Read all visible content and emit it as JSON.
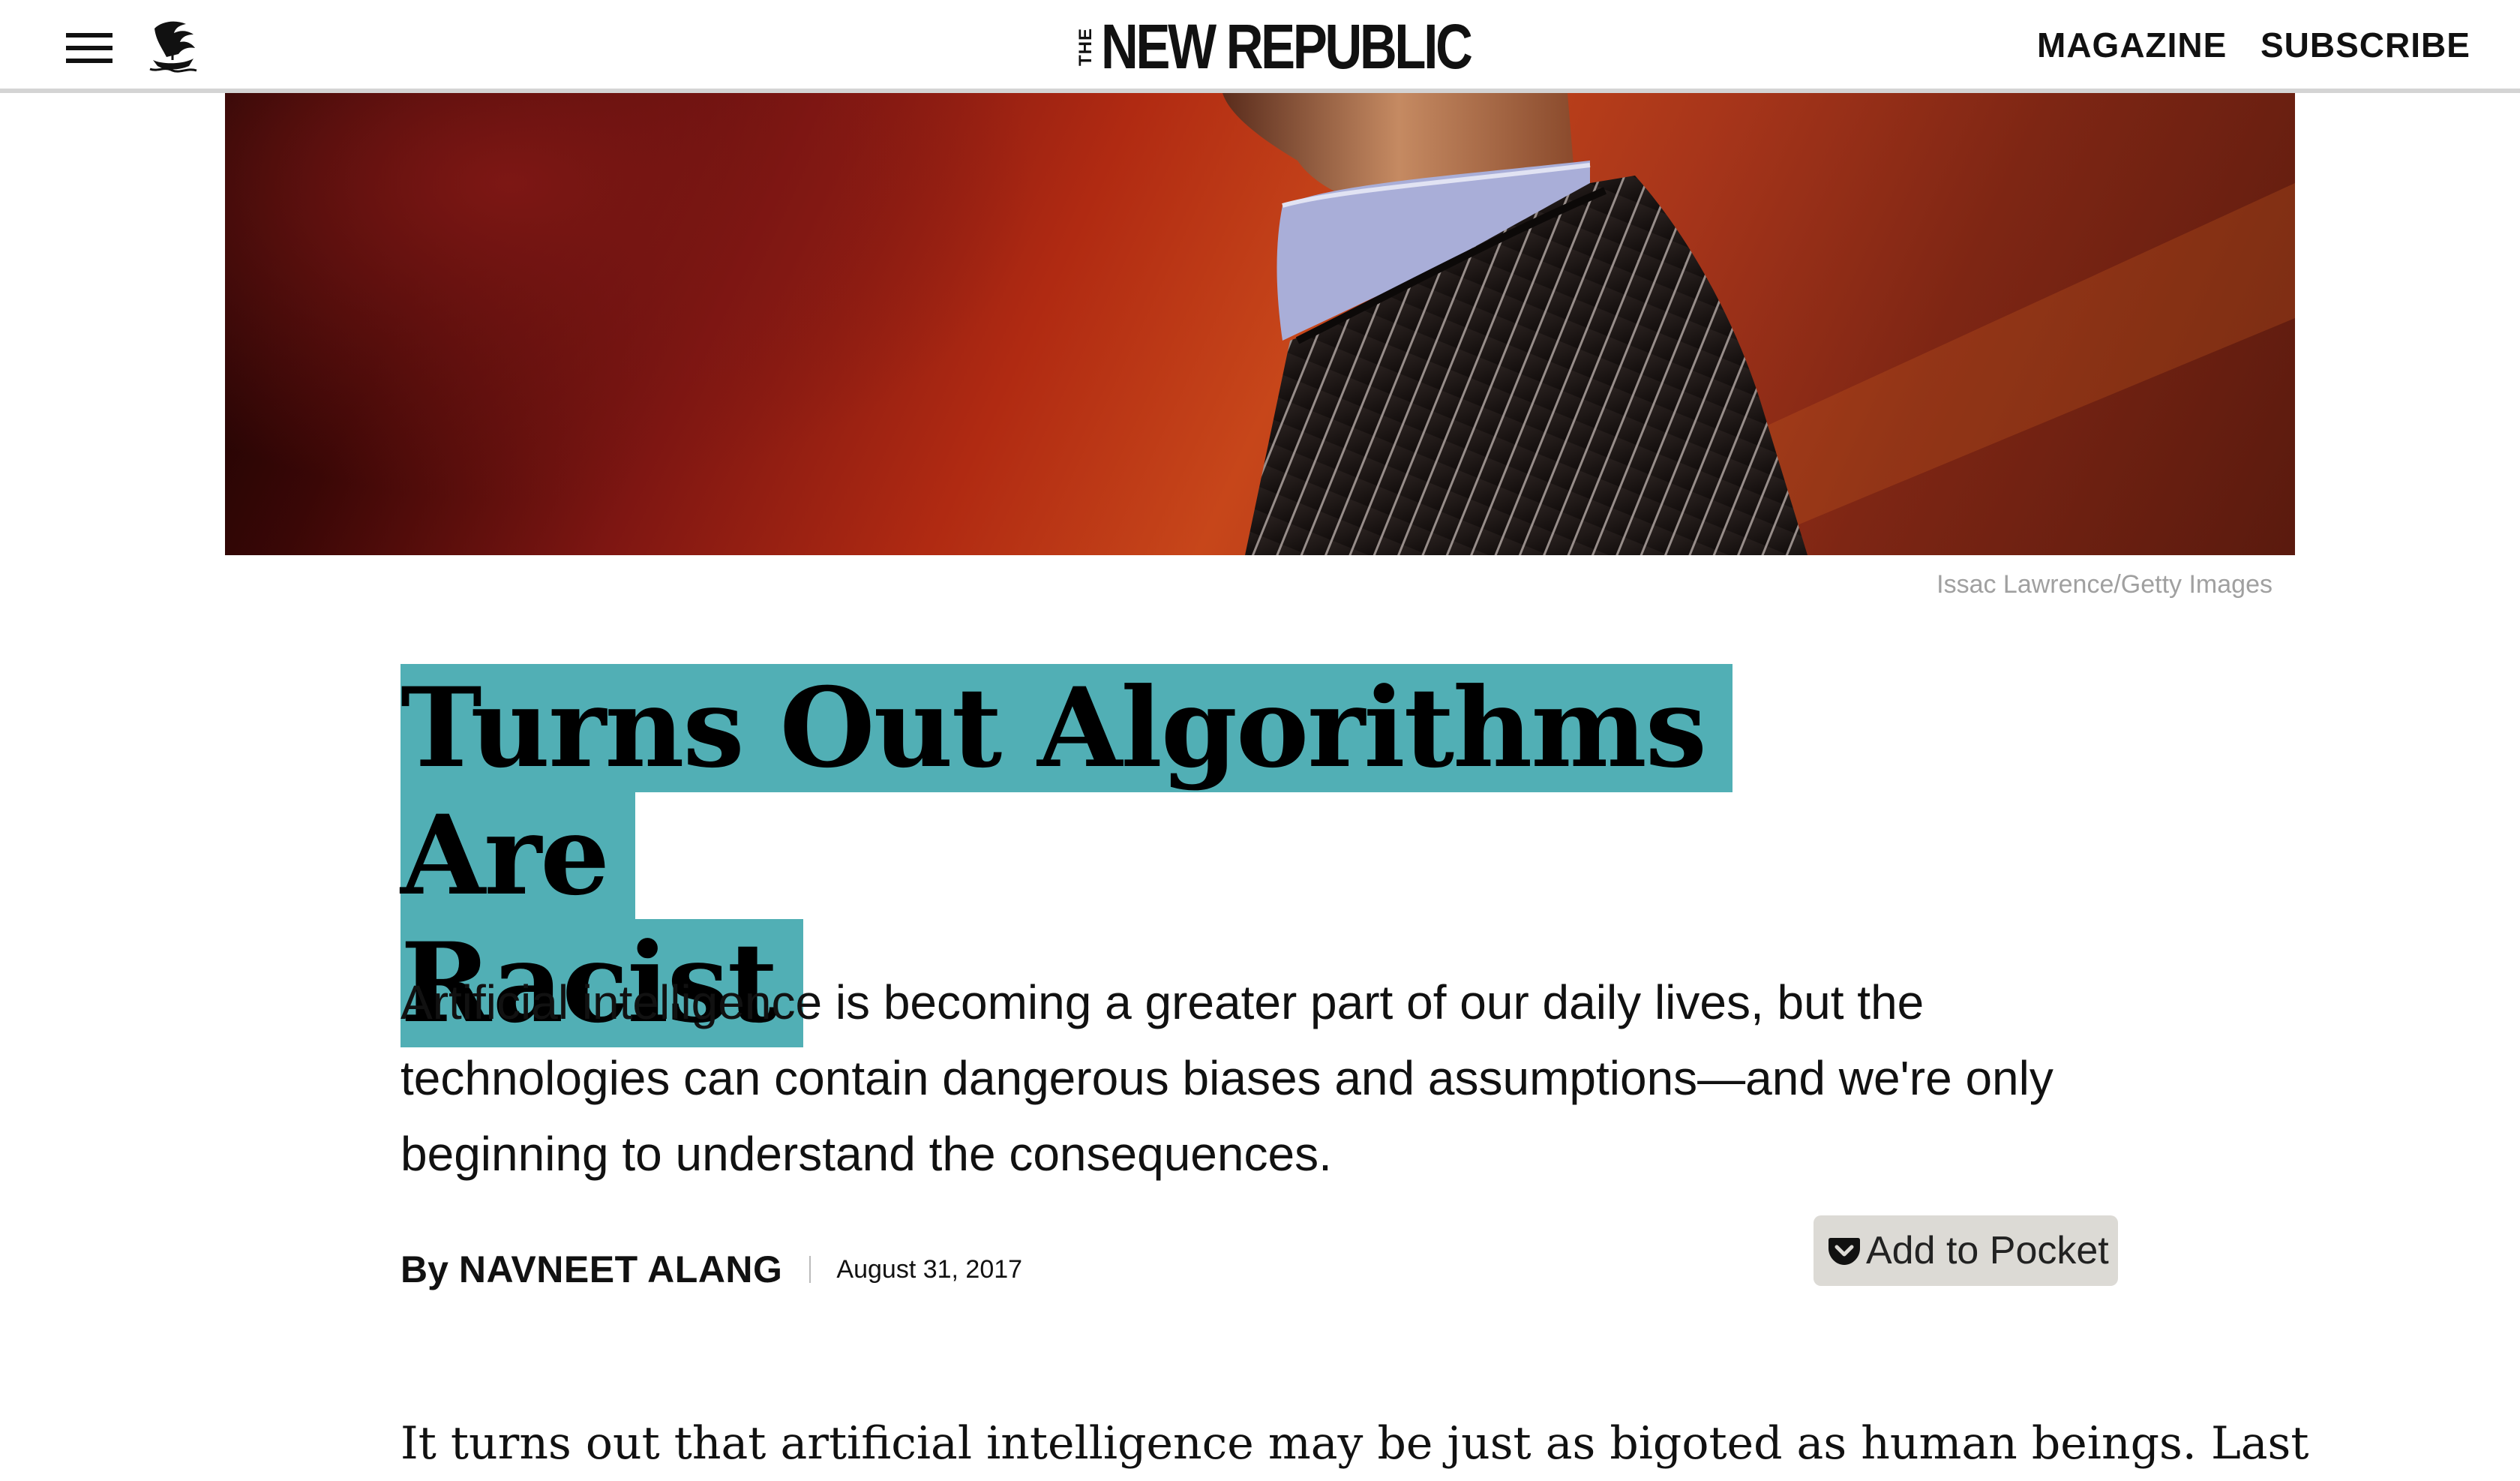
{
  "header": {
    "masthead_prefix": "THE",
    "masthead_name": "NEW REPUBLIC",
    "nav": {
      "magazine": "MAGAZINE",
      "subscribe": "SUBSCRIBE"
    }
  },
  "hero": {
    "credit": "Issac Lawrence/Getty Images"
  },
  "article": {
    "headline_line1": "Turns Out Algorithms Are",
    "headline_line2": "Racist",
    "dek": "Artificial intelligence is becoming a greater part of our daily lives, but the technologies can contain dangerous biases and assumptions—and we're only beginning to understand the consequences.",
    "byline_prefix": "By",
    "author": "NAVNEET ALANG",
    "date": "August 31, 2017",
    "pocket_label": "Add to Pocket",
    "body_first_line": "It turns out that artificial intelligence may be just as bigoted as human beings. Last"
  },
  "colors": {
    "headline_highlight": "#51afb5",
    "pocket_background": "#dcdad5",
    "credit_text": "#a0a0a0"
  },
  "icons": {
    "menu": "hamburger-icon",
    "logo": "ship-logo-icon",
    "pocket": "pocket-icon"
  }
}
